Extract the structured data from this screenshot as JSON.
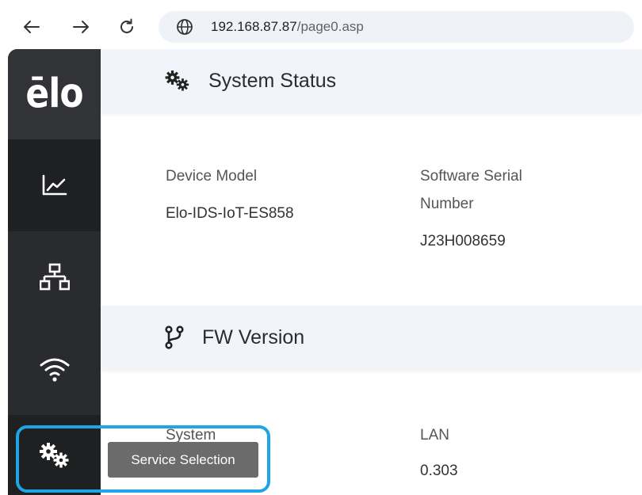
{
  "browser": {
    "url_host": "192.168.87.87",
    "url_path": "/page0.asp",
    "back_icon": "arrow-left-icon",
    "forward_icon": "arrow-right-icon",
    "reload_icon": "reload-icon",
    "site_icon": "globe-icon"
  },
  "sidebar": {
    "logo": "ēlo",
    "items": [
      {
        "icon": "chart-line-icon"
      },
      {
        "icon": "network-icon"
      },
      {
        "icon": "wifi-icon"
      },
      {
        "icon": "gears-icon"
      }
    ]
  },
  "system_status": {
    "title": "System Status",
    "device_model_label": "Device Model",
    "device_model_value": "Elo-IDS-IoT-ES858",
    "serial_label_line1": "Software Serial",
    "serial_label_line2": "Number",
    "serial_value": "J23H008659"
  },
  "fw_version": {
    "title": "FW Version",
    "system_label": "System",
    "lan_label": "LAN",
    "lan_value": "0.303"
  },
  "tooltip": {
    "text": "Service Selection"
  },
  "colors": {
    "sidebar_bg": "#2a2b2e",
    "header_bg": "#f1f4fa",
    "highlight": "#1ea5e6",
    "tooltip_bg": "#6b6b6b"
  }
}
